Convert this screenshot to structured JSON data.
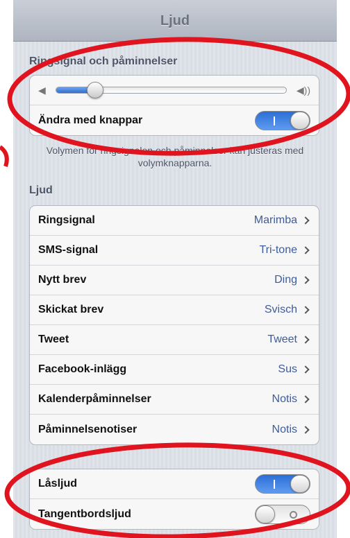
{
  "navbar": {
    "title": "Ljud"
  },
  "ringer": {
    "section_title": "Ringsignal och påminnelser",
    "volume": 0.17,
    "change_with_buttons": {
      "label": "Ändra med knappar",
      "on": true
    }
  },
  "footnote": "Volymen för ringsignalen och påminnelser kan justeras med volymknapparna.",
  "sounds": {
    "section_title": "Ljud",
    "items": [
      {
        "label": "Ringsignal",
        "value": "Marimba"
      },
      {
        "label": "SMS-signal",
        "value": "Tri-tone"
      },
      {
        "label": "Nytt brev",
        "value": "Ding"
      },
      {
        "label": "Skickat brev",
        "value": "Svisch"
      },
      {
        "label": "Tweet",
        "value": "Tweet"
      },
      {
        "label": "Facebook-inlägg",
        "value": "Sus"
      },
      {
        "label": "Kalenderpåminnelser",
        "value": "Notis"
      },
      {
        "label": "Påminnelsenotiser",
        "value": "Notis"
      }
    ]
  },
  "system_sounds": {
    "lock": {
      "label": "Låsljud",
      "on": true
    },
    "keyboard": {
      "label": "Tangentbordsljud",
      "on": false
    }
  },
  "colors": {
    "annotation": "#e0141e",
    "accent": "#2f6fd3",
    "value_text": "#3d5c99"
  }
}
